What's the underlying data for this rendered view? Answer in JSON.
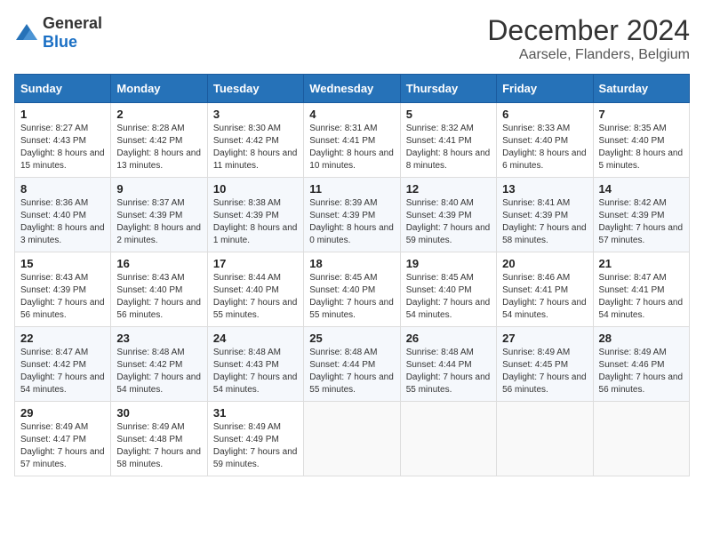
{
  "logo": {
    "general": "General",
    "blue": "Blue"
  },
  "header": {
    "month": "December 2024",
    "location": "Aarsele, Flanders, Belgium"
  },
  "weekdays": [
    "Sunday",
    "Monday",
    "Tuesday",
    "Wednesday",
    "Thursday",
    "Friday",
    "Saturday"
  ],
  "weeks": [
    [
      {
        "day": "1",
        "info": "Sunrise: 8:27 AM\nSunset: 4:43 PM\nDaylight: 8 hours and 15 minutes."
      },
      {
        "day": "2",
        "info": "Sunrise: 8:28 AM\nSunset: 4:42 PM\nDaylight: 8 hours and 13 minutes."
      },
      {
        "day": "3",
        "info": "Sunrise: 8:30 AM\nSunset: 4:42 PM\nDaylight: 8 hours and 11 minutes."
      },
      {
        "day": "4",
        "info": "Sunrise: 8:31 AM\nSunset: 4:41 PM\nDaylight: 8 hours and 10 minutes."
      },
      {
        "day": "5",
        "info": "Sunrise: 8:32 AM\nSunset: 4:41 PM\nDaylight: 8 hours and 8 minutes."
      },
      {
        "day": "6",
        "info": "Sunrise: 8:33 AM\nSunset: 4:40 PM\nDaylight: 8 hours and 6 minutes."
      },
      {
        "day": "7",
        "info": "Sunrise: 8:35 AM\nSunset: 4:40 PM\nDaylight: 8 hours and 5 minutes."
      }
    ],
    [
      {
        "day": "8",
        "info": "Sunrise: 8:36 AM\nSunset: 4:40 PM\nDaylight: 8 hours and 3 minutes."
      },
      {
        "day": "9",
        "info": "Sunrise: 8:37 AM\nSunset: 4:39 PM\nDaylight: 8 hours and 2 minutes."
      },
      {
        "day": "10",
        "info": "Sunrise: 8:38 AM\nSunset: 4:39 PM\nDaylight: 8 hours and 1 minute."
      },
      {
        "day": "11",
        "info": "Sunrise: 8:39 AM\nSunset: 4:39 PM\nDaylight: 8 hours and 0 minutes."
      },
      {
        "day": "12",
        "info": "Sunrise: 8:40 AM\nSunset: 4:39 PM\nDaylight: 7 hours and 59 minutes."
      },
      {
        "day": "13",
        "info": "Sunrise: 8:41 AM\nSunset: 4:39 PM\nDaylight: 7 hours and 58 minutes."
      },
      {
        "day": "14",
        "info": "Sunrise: 8:42 AM\nSunset: 4:39 PM\nDaylight: 7 hours and 57 minutes."
      }
    ],
    [
      {
        "day": "15",
        "info": "Sunrise: 8:43 AM\nSunset: 4:39 PM\nDaylight: 7 hours and 56 minutes."
      },
      {
        "day": "16",
        "info": "Sunrise: 8:43 AM\nSunset: 4:40 PM\nDaylight: 7 hours and 56 minutes."
      },
      {
        "day": "17",
        "info": "Sunrise: 8:44 AM\nSunset: 4:40 PM\nDaylight: 7 hours and 55 minutes."
      },
      {
        "day": "18",
        "info": "Sunrise: 8:45 AM\nSunset: 4:40 PM\nDaylight: 7 hours and 55 minutes."
      },
      {
        "day": "19",
        "info": "Sunrise: 8:45 AM\nSunset: 4:40 PM\nDaylight: 7 hours and 54 minutes."
      },
      {
        "day": "20",
        "info": "Sunrise: 8:46 AM\nSunset: 4:41 PM\nDaylight: 7 hours and 54 minutes."
      },
      {
        "day": "21",
        "info": "Sunrise: 8:47 AM\nSunset: 4:41 PM\nDaylight: 7 hours and 54 minutes."
      }
    ],
    [
      {
        "day": "22",
        "info": "Sunrise: 8:47 AM\nSunset: 4:42 PM\nDaylight: 7 hours and 54 minutes."
      },
      {
        "day": "23",
        "info": "Sunrise: 8:48 AM\nSunset: 4:42 PM\nDaylight: 7 hours and 54 minutes."
      },
      {
        "day": "24",
        "info": "Sunrise: 8:48 AM\nSunset: 4:43 PM\nDaylight: 7 hours and 54 minutes."
      },
      {
        "day": "25",
        "info": "Sunrise: 8:48 AM\nSunset: 4:44 PM\nDaylight: 7 hours and 55 minutes."
      },
      {
        "day": "26",
        "info": "Sunrise: 8:48 AM\nSunset: 4:44 PM\nDaylight: 7 hours and 55 minutes."
      },
      {
        "day": "27",
        "info": "Sunrise: 8:49 AM\nSunset: 4:45 PM\nDaylight: 7 hours and 56 minutes."
      },
      {
        "day": "28",
        "info": "Sunrise: 8:49 AM\nSunset: 4:46 PM\nDaylight: 7 hours and 56 minutes."
      }
    ],
    [
      {
        "day": "29",
        "info": "Sunrise: 8:49 AM\nSunset: 4:47 PM\nDaylight: 7 hours and 57 minutes."
      },
      {
        "day": "30",
        "info": "Sunrise: 8:49 AM\nSunset: 4:48 PM\nDaylight: 7 hours and 58 minutes."
      },
      {
        "day": "31",
        "info": "Sunrise: 8:49 AM\nSunset: 4:49 PM\nDaylight: 7 hours and 59 minutes."
      },
      null,
      null,
      null,
      null
    ]
  ]
}
